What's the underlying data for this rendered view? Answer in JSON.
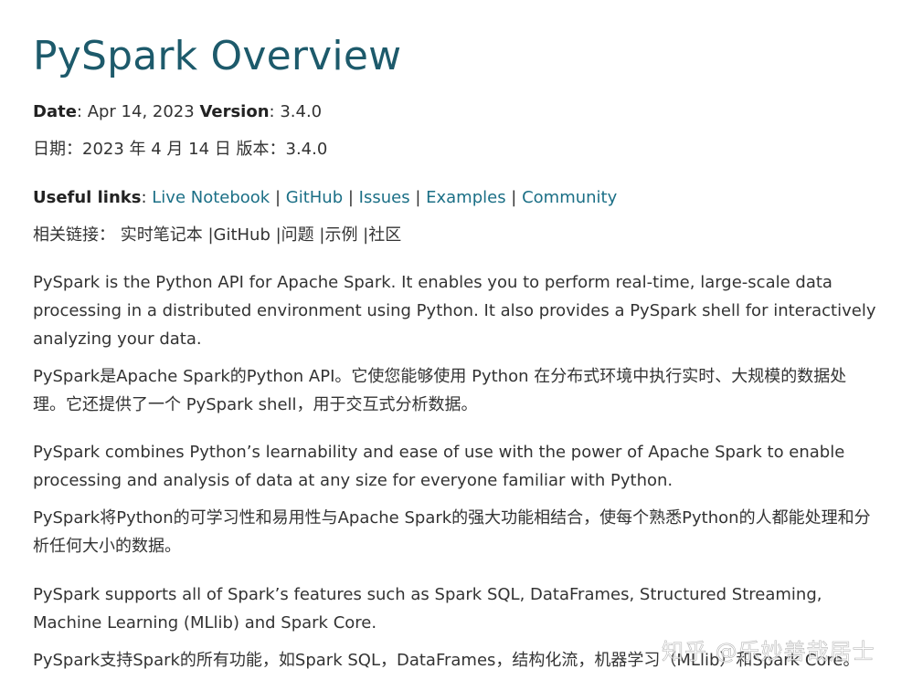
{
  "title": "PySpark Overview",
  "meta": {
    "date_label": "Date",
    "date_value": ": Apr 14, 2023 ",
    "version_label": "Version",
    "version_value": ": 3.4.0",
    "zh_line": "日期：2023 年 4 月 14 日 版本：3.4.0"
  },
  "links": {
    "label": "Useful links",
    "colon": ": ",
    "items": [
      "Live Notebook",
      "GitHub",
      "Issues",
      "Examples",
      "Community"
    ],
    "separator": " | ",
    "zh_line": "相关链接： 实时笔记本 |GitHub |问题 |示例 |社区"
  },
  "paragraphs": [
    {
      "en": "PySpark is the Python API for Apache Spark. It enables you to perform real-time, large-scale data processing in a distributed environment using Python. It also provides a PySpark shell for interactively analyzing your data.",
      "zh": "PySpark是Apache Spark的Python API。它使您能够使用 Python 在分布式环境中执行实时、大规模的数据处理。它还提供了一个 PySpark shell，用于交互式分析数据。"
    },
    {
      "en": "PySpark combines Python’s learnability and ease of use with the power of Apache Spark to enable processing and analysis of data at any size for everyone familiar with Python.",
      "zh": "PySpark将Python的可学习性和易用性与Apache Spark的强大功能相结合，使每个熟悉Python的人都能处理和分析任何大小的数据。"
    },
    {
      "en": "PySpark supports all of Spark’s features such as Spark SQL, DataFrames, Structured Streaming, Machine Learning (MLlib) and Spark Core.",
      "zh": "PySpark支持Spark的所有功能，如Spark SQL，DataFrames，结构化流，机器学习（MLlib）和Spark Core。"
    }
  ],
  "watermark": "知乎 @乐妙善哉居士",
  "colors": {
    "title": "#1d5a6b",
    "link": "#1b6f86",
    "text": "#333333"
  }
}
